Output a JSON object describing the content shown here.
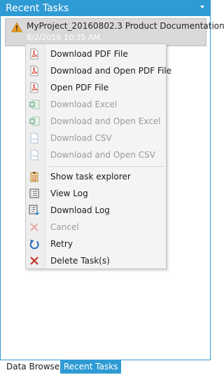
{
  "panel": {
    "title": "Recent Tasks",
    "accent": "#2f9bd4",
    "dropdown_icon": "triangle-down-icon"
  },
  "task": {
    "name": "MyProject_20160802.3 Product Documentation",
    "date": "8/2/2016 10:35 AM",
    "status_icon": "warning-icon"
  },
  "menu": {
    "items": [
      {
        "label": "Download PDF File",
        "icon": "pdf-icon",
        "enabled": true
      },
      {
        "label": "Download and Open PDF File",
        "icon": "pdf-icon",
        "enabled": true
      },
      {
        "label": "Open PDF File",
        "icon": "pdf-icon",
        "enabled": true
      },
      {
        "label": "Download Excel",
        "icon": "excel-icon",
        "enabled": false
      },
      {
        "label": "Download and Open Excel",
        "icon": "excel-icon",
        "enabled": false
      },
      {
        "label": "Download CSV",
        "icon": "csv-icon",
        "enabled": false
      },
      {
        "label": "Download and Open CSV",
        "icon": "csv-icon",
        "enabled": false
      },
      {
        "label": "Show task explorer",
        "icon": "clipboard-icon",
        "enabled": true
      },
      {
        "label": "View Log",
        "icon": "log-icon",
        "enabled": true
      },
      {
        "label": "Download Log",
        "icon": "download-log-icon",
        "enabled": true
      },
      {
        "label": "Cancel",
        "icon": "cancel-icon",
        "enabled": false
      },
      {
        "label": "Retry",
        "icon": "retry-icon",
        "enabled": true
      },
      {
        "label": "Delete Task(s)",
        "icon": "delete-icon",
        "enabled": true
      }
    ]
  },
  "tabs": [
    {
      "label": "Data Browser",
      "active": false
    },
    {
      "label": "Recent Tasks",
      "active": true
    }
  ]
}
